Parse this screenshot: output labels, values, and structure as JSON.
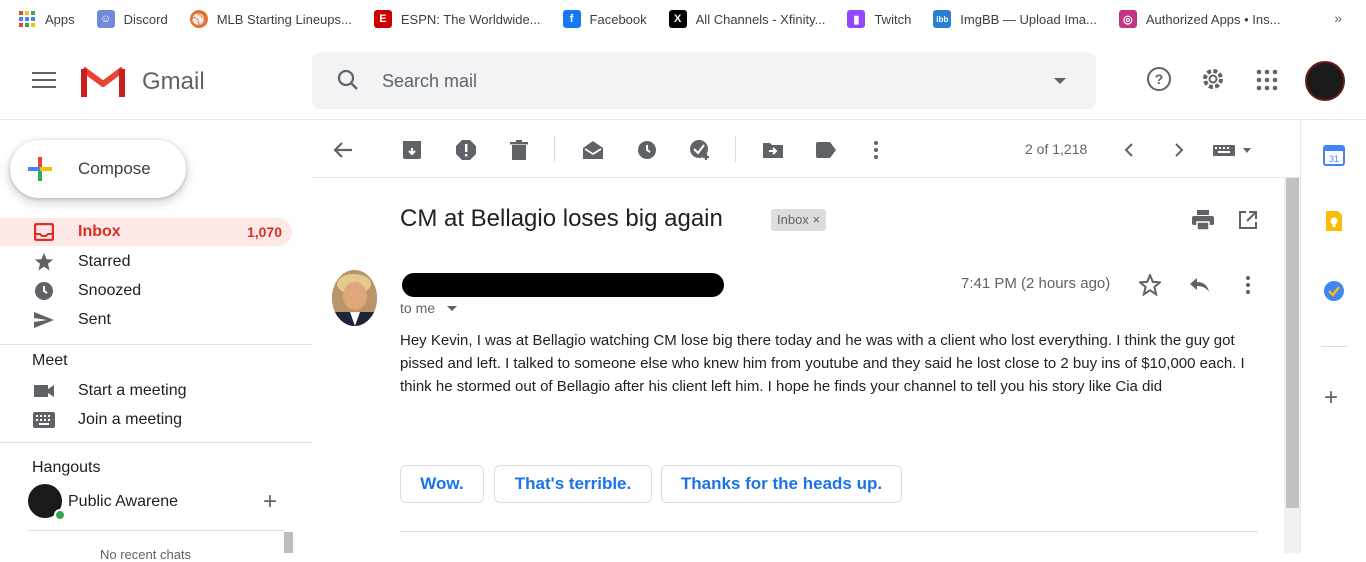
{
  "bookmarks": [
    {
      "label": "Apps",
      "icon": "apps-grid-icon",
      "color": "#4285f4"
    },
    {
      "label": "Discord",
      "icon": "discord-icon",
      "color": "#7289da"
    },
    {
      "label": "MLB Starting Lineups...",
      "icon": "mlb-icon",
      "color": "#e8702a"
    },
    {
      "label": "ESPN: The Worldwide...",
      "icon": "espn-icon",
      "color": "#cc0000"
    },
    {
      "label": "Facebook",
      "icon": "facebook-icon",
      "color": "#1877f2"
    },
    {
      "label": "All Channels - Xfinity...",
      "icon": "x-icon",
      "color": "#000000"
    },
    {
      "label": "Twitch",
      "icon": "twitch-icon",
      "color": "#9146ff"
    },
    {
      "label": "ImgBB — Upload Ima...",
      "icon": "imgbb-icon",
      "color": "#2a7fd4"
    },
    {
      "label": "Authorized Apps • Ins...",
      "icon": "instagram-icon",
      "color": "#c13584"
    }
  ],
  "bookmarks_more": "»",
  "header": {
    "app_name": "Gmail",
    "search_placeholder": "Search mail"
  },
  "sidebar": {
    "compose_label": "Compose",
    "nav": [
      {
        "label": "Inbox",
        "count": "1,070",
        "icon": "inbox-icon"
      },
      {
        "label": "Starred",
        "count": "",
        "icon": "star-icon"
      },
      {
        "label": "Snoozed",
        "count": "",
        "icon": "clock-icon"
      },
      {
        "label": "Sent",
        "count": "",
        "icon": "send-icon"
      }
    ],
    "meet_title": "Meet",
    "meet_items": [
      {
        "label": "Start a meeting",
        "icon": "video-icon"
      },
      {
        "label": "Join a meeting",
        "icon": "keyboard-icon"
      }
    ],
    "hangouts_title": "Hangouts",
    "hangouts_user": "Public Awarene",
    "hangouts_partial": "No recent chats"
  },
  "toolbar": {
    "count": "2 of 1,218"
  },
  "message": {
    "subject": "CM at Bellagio loses big again",
    "label_badge": "Inbox",
    "label_badge_close": "×",
    "to": "to me",
    "time": "7:41 PM (2 hours ago)",
    "body": "Hey Kevin, I was at Bellagio watching CM lose big there today and he was with a client who lost everything. I think the guy got pissed and left. I talked to someone else who knew him from youtube and they said he lost close to 2 buy ins of $10,000 each. I think he stormed out of Bellagio after his client left him. I hope he finds your channel to tell you his story like Cia did",
    "smart_replies": [
      "Wow.",
      "That's terrible.",
      "Thanks for the heads up."
    ]
  },
  "colors": {
    "accent_red": "#d93025",
    "link_blue": "#1a73e8",
    "inbox_highlight": "#fce8e6"
  }
}
